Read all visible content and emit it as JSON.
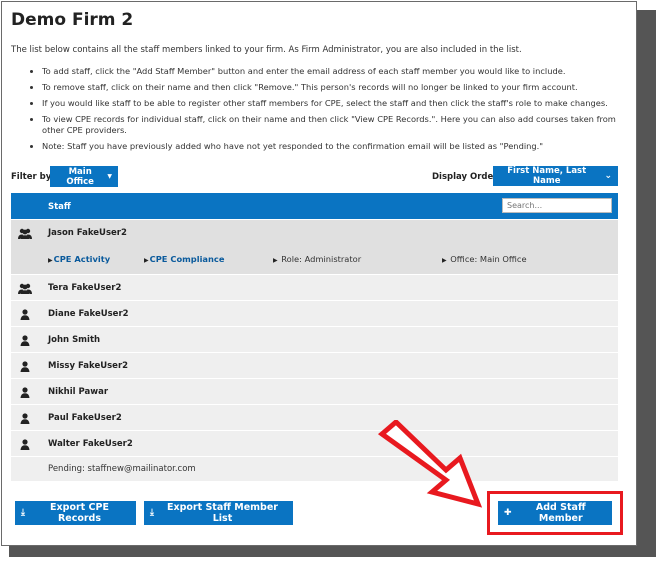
{
  "page": {
    "title": "Demo Firm 2",
    "intro": "The list below contains all the staff members linked to your firm. As Firm Administrator, you are also included in the list.",
    "instructions": [
      "To add staff, click the \"Add Staff Member\" button and enter the email address of each staff member you would like to include.",
      "To remove staff, click on their name and then click \"Remove.\" This person's records will no longer be linked to your firm account.",
      "If you would like staff to be able to register other staff members for CPE, select the staff and then click the staff's role to make changes.",
      "To view CPE records for individual staff, click on their name and then click \"View CPE Records.\". Here you can also add courses taken from other CPE providers.",
      "Note: Staff you have previously added who have not yet responded to the confirmation email will be listed as \"Pending.\""
    ]
  },
  "filter": {
    "label": "Filter by:",
    "value": "Main Office"
  },
  "order": {
    "label": "Display Order:",
    "value": "First Name, Last Name"
  },
  "table": {
    "column": "Staff",
    "search_placeholder": "Search...",
    "expanded": {
      "cpe_activity": "CPE Activity",
      "cpe_compliance": "CPE Compliance",
      "role": "Role: Administrator",
      "office": "Office: Main Office"
    },
    "rows": [
      {
        "name": "Jason FakeUser2",
        "icon": "group-icon"
      },
      {
        "name": "Tera FakeUser2",
        "icon": "group-icon"
      },
      {
        "name": "Diane FakeUser2",
        "icon": "user-icon"
      },
      {
        "name": "John Smith",
        "icon": "user-icon"
      },
      {
        "name": "Missy FakeUser2",
        "icon": "user-icon"
      },
      {
        "name": "Nikhil Pawar",
        "icon": "user-icon"
      },
      {
        "name": "Paul FakeUser2",
        "icon": "user-icon"
      },
      {
        "name": "Walter FakeUser2",
        "icon": "user-icon"
      }
    ],
    "pending": "Pending: staffnew@mailinator.com"
  },
  "buttons": {
    "export_cpe": "Export CPE Records",
    "export_staff": "Export Staff Member List",
    "add_staff": "Add Staff Member"
  },
  "colors": {
    "primary": "#0a74c2",
    "annotation": "#e8191f"
  }
}
